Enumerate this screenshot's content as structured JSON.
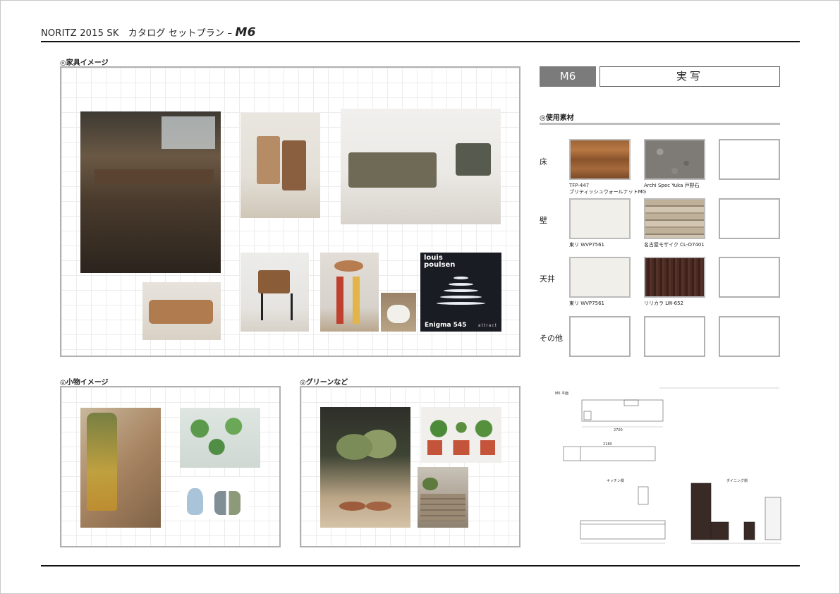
{
  "header": {
    "title": "NORITZ 2015 SK　カタログ セットプラン – ",
    "code": "M6"
  },
  "sections": {
    "furniture": "◎家具イメージ",
    "accessories": "◎小物イメージ",
    "greenery": "◎グリーンなど",
    "materials": "◎使用素材"
  },
  "lamp": {
    "brand_line1": "louis",
    "brand_line2": "poulsen",
    "product": "Enigma 545",
    "maker": "attract"
  },
  "plan": {
    "tag": "M6",
    "photo_label": "実写"
  },
  "material_rows": {
    "floor": "床",
    "wall": "壁",
    "ceiling": "天井",
    "other": "その他"
  },
  "materials": {
    "floor_1": "TFP-447\nブリティッシュウォールナットMG",
    "floor_2": "Archi Spec Yuka 戸野石",
    "wall_1": "東リ WVP7561",
    "wall_2": "名古屋モザイク CL-O7401",
    "ceiling_1": "東リ WVP7561",
    "ceiling_2": "リリカラ LW-652"
  },
  "drawing": {
    "plan_label": "M6\n平面",
    "kitchen_side": "キッチン側",
    "dining_side": "ダイニング側",
    "dim_total": "2700",
    "dim_upper": "2180"
  }
}
